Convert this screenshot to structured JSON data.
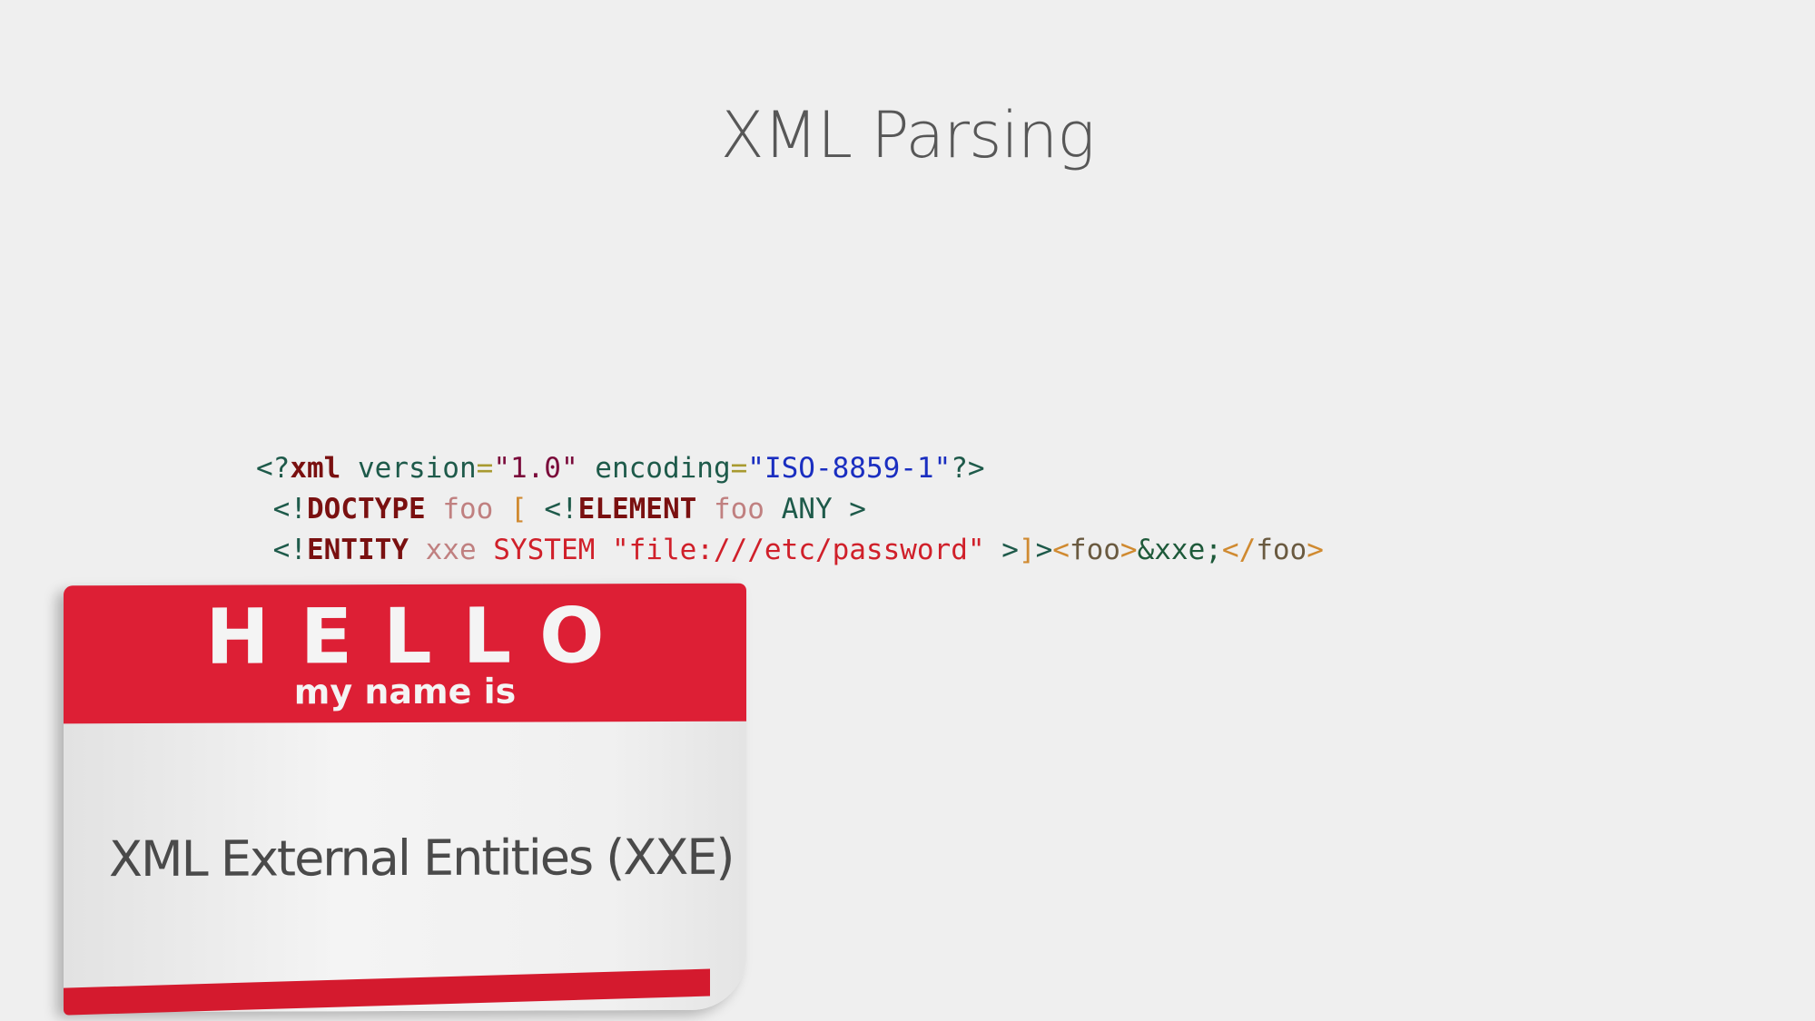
{
  "slide": {
    "title": "XML Parsing"
  },
  "code": {
    "lines": [
      [
        {
          "text": "<?",
          "color": "#1e5a4a",
          "bold": false
        },
        {
          "text": "xml",
          "color": "#7a1010",
          "bold": true
        },
        {
          "text": " version",
          "color": "#1e5a4a",
          "bold": false
        },
        {
          "text": "=",
          "color": "#a89a30",
          "bold": false
        },
        {
          "text": "\"1.0\"",
          "color": "#7a0a3a",
          "bold": false
        },
        {
          "text": " encoding",
          "color": "#1e5a4a",
          "bold": false
        },
        {
          "text": "=",
          "color": "#a89a30",
          "bold": false
        },
        {
          "text": "\"ISO-8859-1\"",
          "color": "#1a2ec0",
          "bold": false
        },
        {
          "text": "?>",
          "color": "#1e5a4a",
          "bold": false
        }
      ],
      [
        {
          "text": " <!",
          "color": "#1e5a4a",
          "bold": false
        },
        {
          "text": "DOCTYPE",
          "color": "#7a1010",
          "bold": true
        },
        {
          "text": " foo ",
          "color": "#c08080",
          "bold": false
        },
        {
          "text": "[",
          "color": "#d08a30",
          "bold": false
        },
        {
          "text": " <!",
          "color": "#1e5a4a",
          "bold": false
        },
        {
          "text": "ELEMENT",
          "color": "#7a1010",
          "bold": true
        },
        {
          "text": " foo",
          "color": "#c08080",
          "bold": false
        },
        {
          "text": " ANY >",
          "color": "#1e5a4a",
          "bold": false
        }
      ],
      [
        {
          "text": " <!",
          "color": "#1e5a4a",
          "bold": false
        },
        {
          "text": "ENTITY",
          "color": "#7a1010",
          "bold": true
        },
        {
          "text": " xxe",
          "color": "#c08080",
          "bold": false
        },
        {
          "text": " SYSTEM \"file:///etc/password\"",
          "color": "#d0202a",
          "bold": false
        },
        {
          "text": " >",
          "color": "#1e5a4a",
          "bold": false
        },
        {
          "text": "]",
          "color": "#d08a30",
          "bold": false
        },
        {
          "text": ">",
          "color": "#1e5a4a",
          "bold": false
        },
        {
          "text": "<",
          "color": "#d08a30",
          "bold": false
        },
        {
          "text": "foo",
          "color": "#6a5a40",
          "bold": false
        },
        {
          "text": ">",
          "color": "#d08a30",
          "bold": false
        },
        {
          "text": "&xxe;",
          "color": "#1e5a3a",
          "bold": false
        },
        {
          "text": "</",
          "color": "#d08a30",
          "bold": false
        },
        {
          "text": "foo",
          "color": "#6a5a40",
          "bold": false
        },
        {
          "text": ">",
          "color": "#d08a30",
          "bold": false
        }
      ]
    ]
  },
  "badge": {
    "hello": "HELLO",
    "subtitle": "my name is",
    "name": "XML External Entities (XXE)",
    "color": "#dd1f35"
  }
}
